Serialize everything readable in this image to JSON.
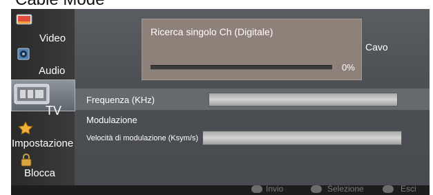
{
  "page": {
    "title": "Cable Mode"
  },
  "sidebar": {
    "items": [
      {
        "label": "Video",
        "icon": "video-icon"
      },
      {
        "label": "Audio",
        "icon": "speaker-icon"
      },
      {
        "label": "TV",
        "icon": "tv-icon",
        "selected": true
      },
      {
        "label": "Impostazione",
        "icon": "star-icon"
      },
      {
        "label": "Blocca",
        "icon": "padlock-icon"
      }
    ]
  },
  "scan_dialog": {
    "title": "Ricerca singolo Ch (Digitale)",
    "progress": 0,
    "progress_text": "0%"
  },
  "source": {
    "label": "Cavo"
  },
  "settings": {
    "frequency_label": "Frequenza (KHz)",
    "frequency_value": "",
    "modulation_label": "Modulazione",
    "symbol_rate_label": "Velocità di modulazione (Ksym/s)",
    "symbol_rate_value": ""
  },
  "footer": {
    "hints": [
      {
        "label": "Invio",
        "icon": "enter-icon"
      },
      {
        "label": "Selezione",
        "icon": "dpad-icon"
      },
      {
        "label": "Esci",
        "icon": "exit-icon"
      }
    ]
  },
  "colors": {
    "panel": "#4a4a4a",
    "dialog": "#8e8179",
    "highlight": "#8e959c"
  }
}
